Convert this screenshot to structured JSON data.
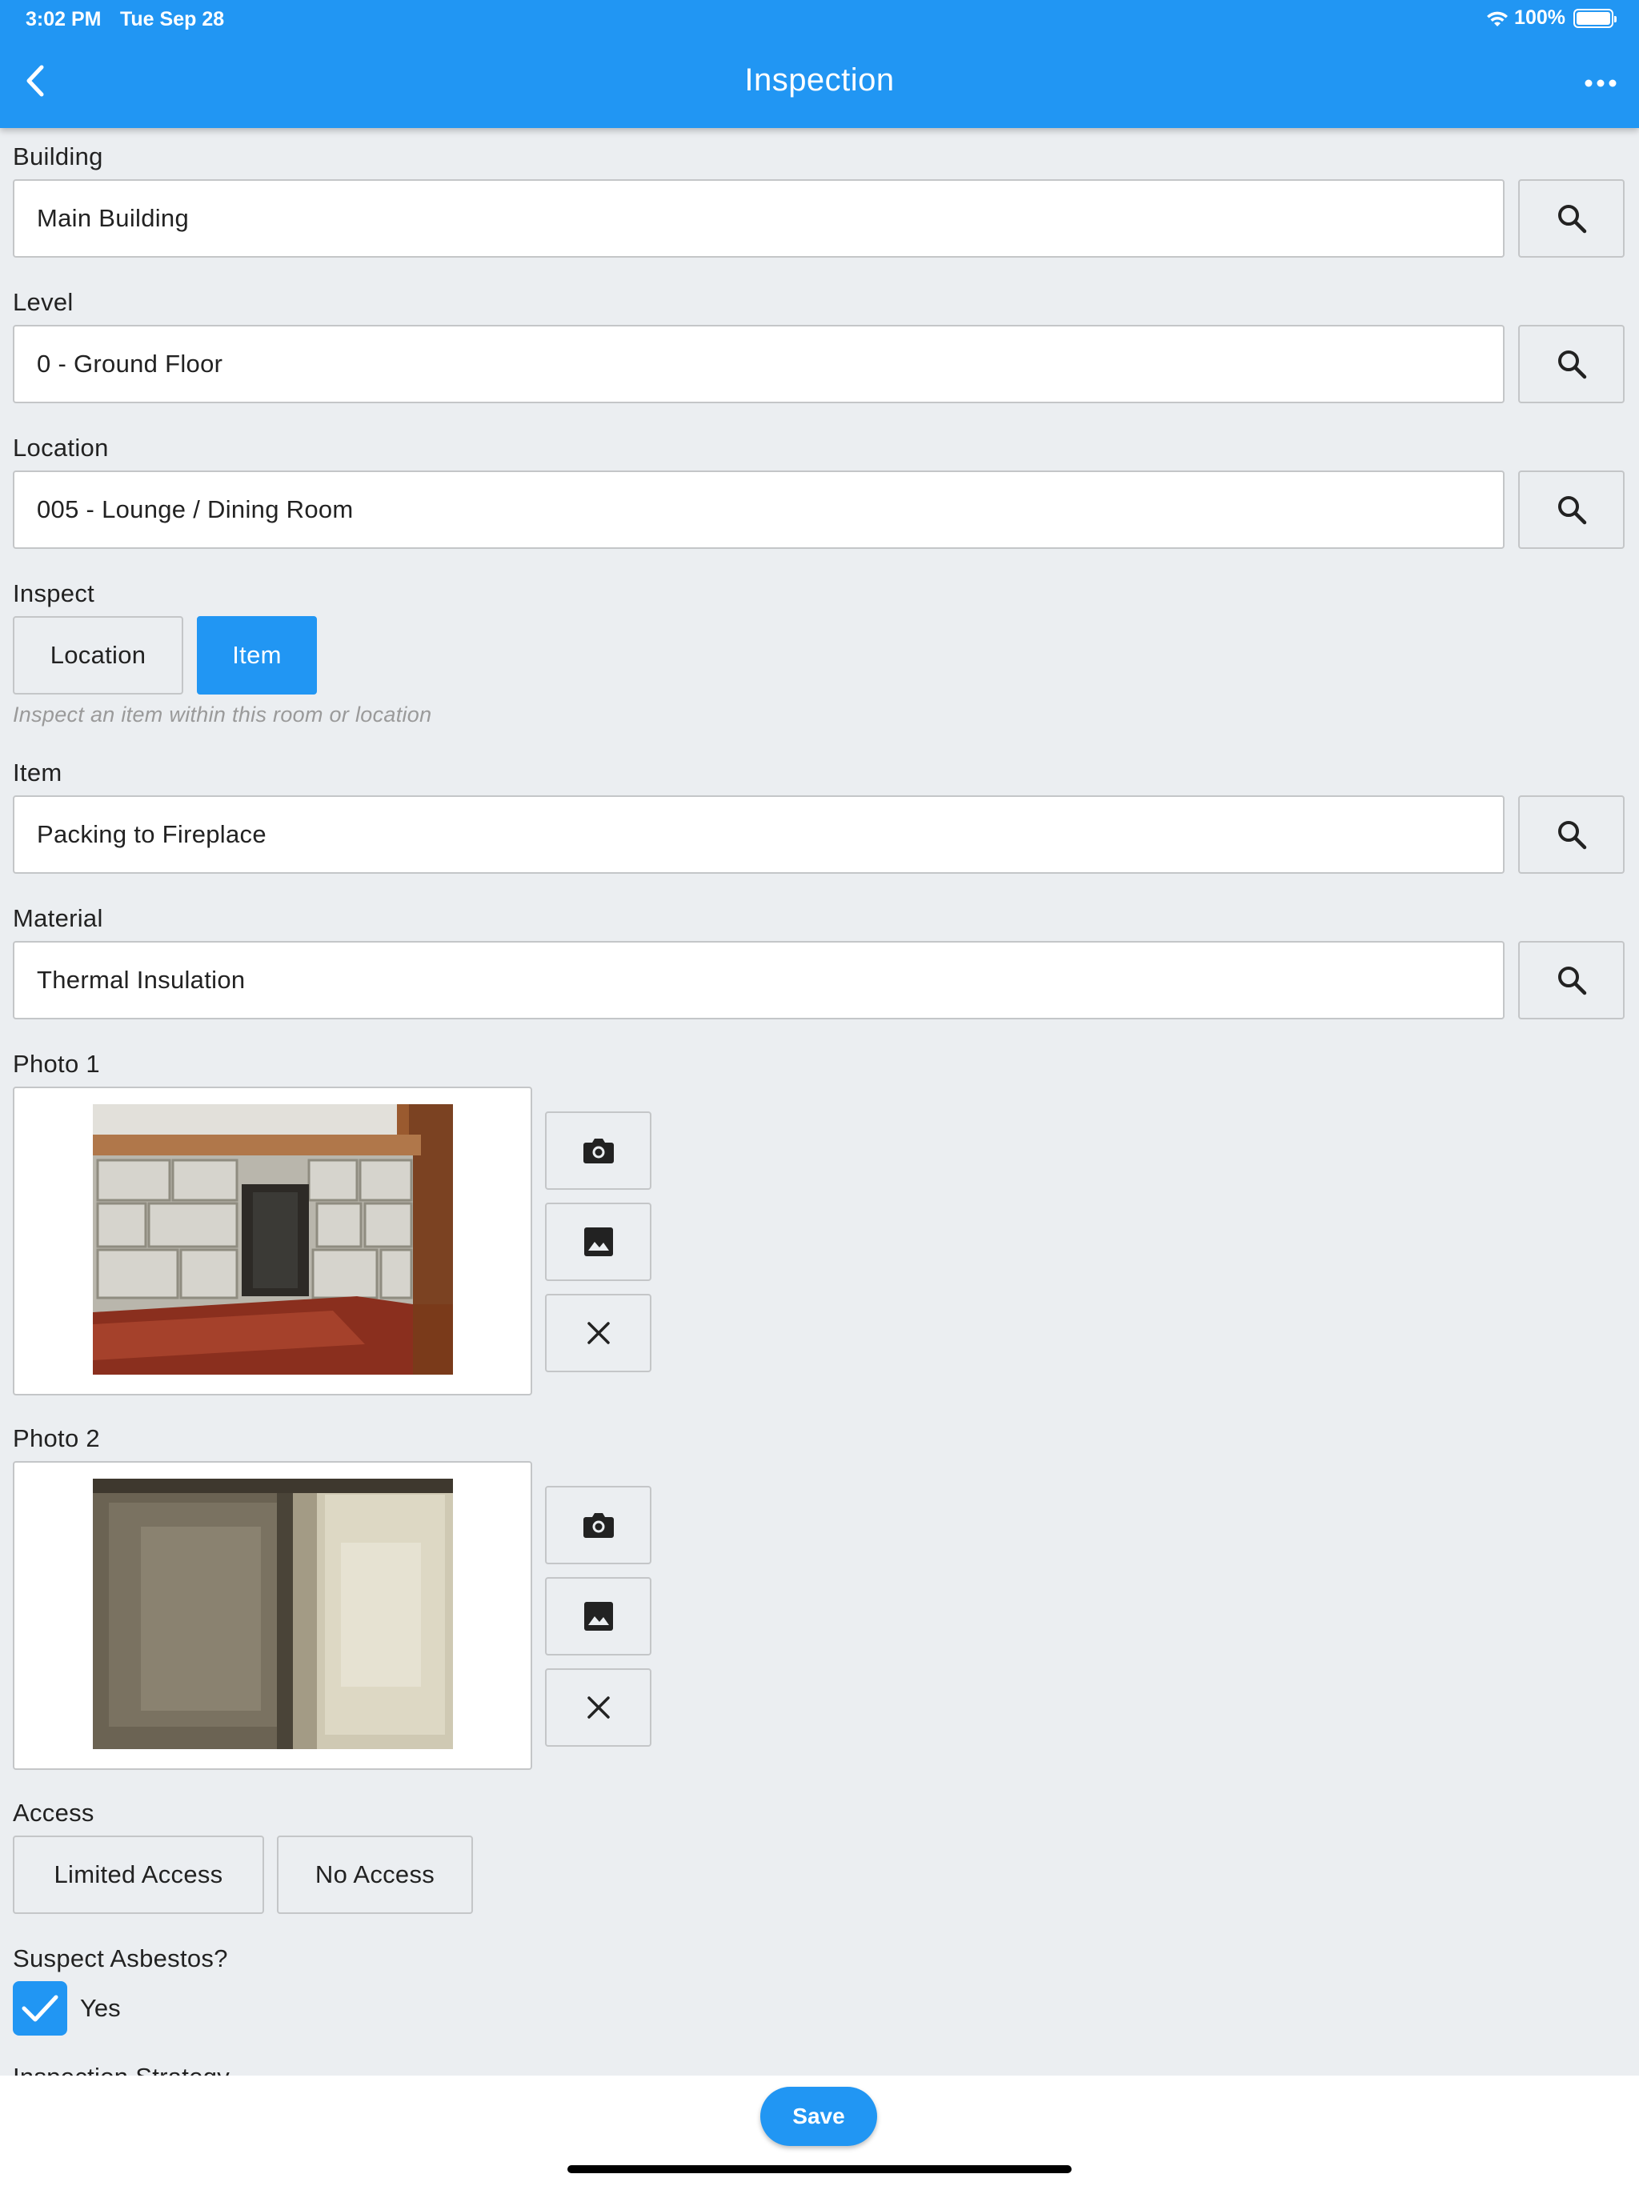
{
  "status_bar": {
    "time": "3:02 PM",
    "date": "Tue Sep 28",
    "battery_text": "100%",
    "battery_level": 1.0
  },
  "header": {
    "title": "Inspection",
    "back_icon": "chevron-left-icon",
    "more_icon": "more-horizontal-icon"
  },
  "fields": {
    "building": {
      "label": "Building",
      "value": "Main Building"
    },
    "level": {
      "label": "Level",
      "value": "0 - Ground Floor"
    },
    "location": {
      "label": "Location",
      "value": "005 - Lounge / Dining Room"
    },
    "item": {
      "label": "Item",
      "value": "Packing to Fireplace"
    },
    "material": {
      "label": "Material",
      "value": "Thermal Insulation"
    }
  },
  "inspect": {
    "label": "Inspect",
    "options": [
      "Location",
      "Item"
    ],
    "selected": "Item",
    "hint": "Inspect an item within this room or location"
  },
  "photos": [
    {
      "label": "Photo 1"
    },
    {
      "label": "Photo 2"
    }
  ],
  "access": {
    "label": "Access",
    "options": [
      "Limited Access",
      "No Access"
    ]
  },
  "suspect_asbestos": {
    "label": "Suspect Asbestos?",
    "checkbox_label": "Yes",
    "checked": true
  },
  "next_section_label": "Inspection Strategy",
  "footer": {
    "save_label": "Save"
  },
  "colors": {
    "primary": "#2196f3",
    "background": "#ebeef1",
    "border": "#c4c6c8"
  }
}
